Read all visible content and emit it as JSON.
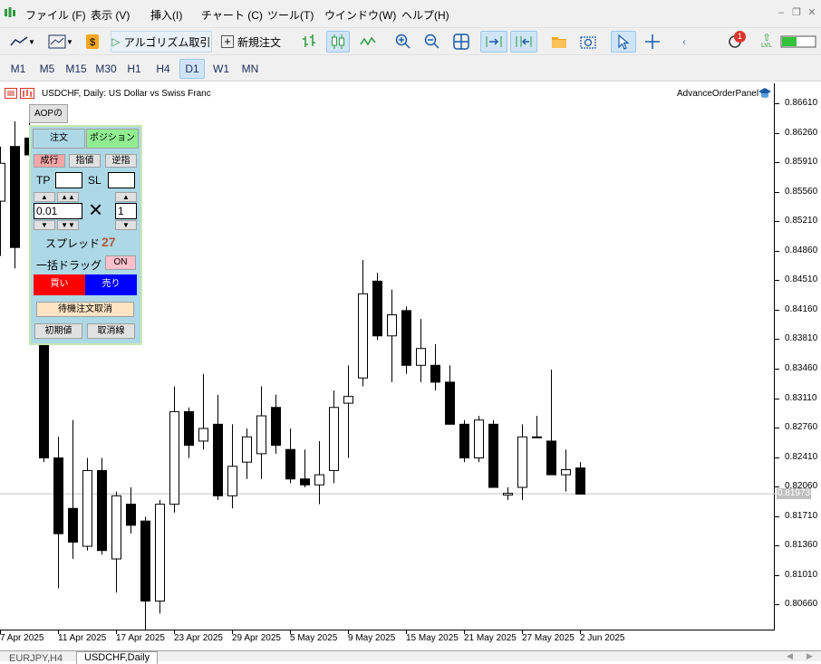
{
  "menubar": {
    "items": [
      "ファイル (F)",
      "表示 (V)",
      "挿入(I)",
      "チャート (C)",
      "ツール(T)",
      "ウインドウ(W)",
      "ヘルプ(H)"
    ]
  },
  "toolbar": {
    "algo_label": "アルゴリズム取引",
    "new_order_label": "新規注文",
    "notification_count": "1",
    "signal_label": "LVL"
  },
  "timeframes": [
    "M1",
    "M5",
    "M15",
    "M30",
    "H1",
    "H4",
    "D1",
    "W1",
    "MN"
  ],
  "active_timeframe": "D1",
  "chart": {
    "title": "USDCHF, Daily:  US Dollar vs Swiss Franc",
    "panel_name": "AdvanceOrderPanel",
    "current_price": "0.81973",
    "price_labels": [
      "0.86610",
      "0.86260",
      "0.85910",
      "0.85560",
      "0.85210",
      "0.84860",
      "0.84510",
      "0.84160",
      "0.83810",
      "0.83460",
      "0.83110",
      "0.82760",
      "0.82410",
      "0.82060",
      "0.81710",
      "0.81360",
      "0.81010",
      "0.80660"
    ],
    "date_labels": [
      "7 Apr 2025",
      "11 Apr 2025",
      "17 Apr 2025",
      "23 Apr 2025",
      "29 Apr 2025",
      "5 May 2025",
      "9 May 2025",
      "15 May 2025",
      "21 May 2025",
      "27 May 2025",
      "2 Jun 2025"
    ]
  },
  "chart_data": {
    "type": "candlestick",
    "title": "USDCHF, Daily:  US Dollar vs Swiss Franc",
    "ylim": [
      0.8035,
      0.8685
    ],
    "current_price": 0.81973,
    "candles": [
      {
        "o": 0.8545,
        "h": 0.861,
        "l": 0.848,
        "c": 0.859
      },
      {
        "o": 0.861,
        "h": 0.864,
        "l": 0.8465,
        "c": 0.849
      },
      {
        "o": 0.862,
        "h": 0.865,
        "l": 0.848,
        "c": 0.86
      },
      {
        "o": 0.838,
        "h": 0.839,
        "l": 0.8235,
        "c": 0.824
      },
      {
        "o": 0.824,
        "h": 0.8265,
        "l": 0.8085,
        "c": 0.815
      },
      {
        "o": 0.818,
        "h": 0.8285,
        "l": 0.812,
        "c": 0.814
      },
      {
        "o": 0.8135,
        "h": 0.824,
        "l": 0.813,
        "c": 0.8225
      },
      {
        "o": 0.8225,
        "h": 0.824,
        "l": 0.8125,
        "c": 0.813
      },
      {
        "o": 0.812,
        "h": 0.82,
        "l": 0.808,
        "c": 0.8195
      },
      {
        "o": 0.8185,
        "h": 0.8205,
        "l": 0.815,
        "c": 0.816
      },
      {
        "o": 0.8165,
        "h": 0.817,
        "l": 0.8025,
        "c": 0.807
      },
      {
        "o": 0.807,
        "h": 0.819,
        "l": 0.8055,
        "c": 0.8185
      },
      {
        "o": 0.8185,
        "h": 0.8325,
        "l": 0.8175,
        "c": 0.8295
      },
      {
        "o": 0.8295,
        "h": 0.83,
        "l": 0.824,
        "c": 0.8255
      },
      {
        "o": 0.826,
        "h": 0.834,
        "l": 0.825,
        "c": 0.8275
      },
      {
        "o": 0.828,
        "h": 0.8315,
        "l": 0.819,
        "c": 0.8195
      },
      {
        "o": 0.8195,
        "h": 0.828,
        "l": 0.818,
        "c": 0.823
      },
      {
        "o": 0.8235,
        "h": 0.8275,
        "l": 0.8215,
        "c": 0.8265
      },
      {
        "o": 0.8245,
        "h": 0.8325,
        "l": 0.8215,
        "c": 0.829
      },
      {
        "o": 0.83,
        "h": 0.8315,
        "l": 0.8245,
        "c": 0.8255
      },
      {
        "o": 0.825,
        "h": 0.8275,
        "l": 0.821,
        "c": 0.8215
      },
      {
        "o": 0.8215,
        "h": 0.825,
        "l": 0.8205,
        "c": 0.8208
      },
      {
        "o": 0.8208,
        "h": 0.826,
        "l": 0.8185,
        "c": 0.822
      },
      {
        "o": 0.8225,
        "h": 0.832,
        "l": 0.821,
        "c": 0.83
      },
      {
        "o": 0.8305,
        "h": 0.835,
        "l": 0.824,
        "c": 0.8313
      },
      {
        "o": 0.8335,
        "h": 0.8475,
        "l": 0.8325,
        "c": 0.8435
      },
      {
        "o": 0.845,
        "h": 0.846,
        "l": 0.838,
        "c": 0.8385
      },
      {
        "o": 0.8385,
        "h": 0.844,
        "l": 0.833,
        "c": 0.841
      },
      {
        "o": 0.8415,
        "h": 0.842,
        "l": 0.834,
        "c": 0.835
      },
      {
        "o": 0.835,
        "h": 0.8405,
        "l": 0.833,
        "c": 0.837
      },
      {
        "o": 0.835,
        "h": 0.8375,
        "l": 0.832,
        "c": 0.833
      },
      {
        "o": 0.833,
        "h": 0.835,
        "l": 0.828,
        "c": 0.828
      },
      {
        "o": 0.828,
        "h": 0.8285,
        "l": 0.8235,
        "c": 0.824
      },
      {
        "o": 0.824,
        "h": 0.829,
        "l": 0.8235,
        "c": 0.8285
      },
      {
        "o": 0.828,
        "h": 0.8285,
        "l": 0.8205,
        "c": 0.8205
      },
      {
        "o": 0.8196,
        "h": 0.8205,
        "l": 0.819,
        "c": 0.8198
      },
      {
        "o": 0.8205,
        "h": 0.828,
        "l": 0.819,
        "c": 0.8265
      },
      {
        "o": 0.8265,
        "h": 0.829,
        "l": 0.8265,
        "c": 0.8265
      },
      {
        "o": 0.826,
        "h": 0.8345,
        "l": 0.822,
        "c": 0.822
      },
      {
        "o": 0.822,
        "h": 0.825,
        "l": 0.82,
        "c": 0.8226
      },
      {
        "o": 0.8228,
        "h": 0.8235,
        "l": 0.8197,
        "c": 0.8197
      }
    ]
  },
  "panel": {
    "hide_button": "AOPの非表示",
    "tab_order": "注文",
    "tab_position": "ポジション",
    "btn_market": "成行",
    "btn_limit": "指値",
    "btn_stop": "逆指",
    "tp_label": "TP",
    "tp_value": "",
    "sl_label": "SL",
    "sl_value": "",
    "lot_value": "0.01",
    "multiplier_value": "1",
    "multiply_symbol": "×",
    "spread_label": "スプレッド",
    "spread_value": "27",
    "drag_label": "一括ドラッグ",
    "drag_toggle": "ON",
    "buy_label": "買い",
    "sell_label": "売り",
    "cancel_pending_label": "待機注文取消",
    "reset_label": "初期値",
    "cancel_line_label": "取消線",
    "up_single": "▲",
    "up_double": "▲▲",
    "down_single": "▼",
    "down_double": "▼▼"
  },
  "tabs": [
    "EURJPY,H4",
    "USDCHF,Daily"
  ],
  "active_tab": "USDCHF,Daily",
  "colors": {
    "panel_bg": "#add8e6",
    "buy": "#ff0000",
    "sell": "#0000ff",
    "position_tab": "#90ee90",
    "market_btn": "#f4a6a6",
    "toggle_on": "#ffc0cb",
    "cancel_btn": "#ffe4c4"
  }
}
